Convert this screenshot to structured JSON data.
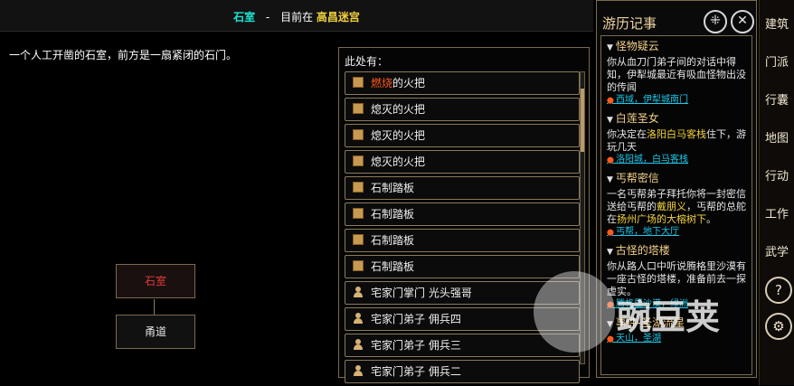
{
  "header": {
    "location": "石室",
    "separator": "-",
    "prefix": "目前在",
    "place": "高昌迷宫"
  },
  "description": "一个人工开凿的石室，前方是一扇紧闭的石门。",
  "map": {
    "current_room": "石室",
    "lower_room": "甬道"
  },
  "here_panel": {
    "header": "此处有：",
    "items": [
      {
        "prefix": "燃烧",
        "label": "的火把",
        "icon": "box-icon"
      },
      {
        "label": "熄灭的火把",
        "icon": "box-icon"
      },
      {
        "label": "熄灭的火把",
        "icon": "box-icon"
      },
      {
        "label": "熄灭的火把",
        "icon": "box-icon"
      },
      {
        "label": "石制踏板",
        "icon": "box-icon"
      },
      {
        "label": "石制踏板",
        "icon": "box-icon"
      },
      {
        "label": "石制踏板",
        "icon": "box-icon"
      },
      {
        "label": "石制踏板",
        "icon": "box-icon"
      },
      {
        "label": "宅家门掌门  光头强哥",
        "icon": "person-icon"
      },
      {
        "label": "宅家门弟子  佣兵四",
        "icon": "person-icon"
      },
      {
        "label": "宅家门弟子  佣兵三",
        "icon": "person-icon"
      },
      {
        "label": "宅家门弟子  佣兵二",
        "icon": "person-icon"
      }
    ]
  },
  "journal": {
    "title": "游历记事",
    "quests": [
      {
        "title": "怪物疑云",
        "text": "你从血刀门弟子间的对话中得知，伊犁城最近有吸血怪物出没的传闻",
        "location": "西域，伊犁城南门"
      },
      {
        "title": "白莲圣女",
        "text_a": "你决定在",
        "hi": "洛阳白马客栈",
        "text_b": "住下，游玩几天",
        "location": "洛阳城，白马客栈"
      },
      {
        "title": "丐帮密信",
        "text_a": "一名丐帮弟子拜托你将一封密信送给丐帮的",
        "hi": "戴朋义",
        "text_b": "，丐帮的总舵在",
        "hi2": "扬州广场的大榕树下",
        "text_c": "。",
        "location": "丐帮，地下大厅"
      },
      {
        "title": "古怪的塔楼",
        "text": "你从路人口中听说腾格里沙漠有一座古怪的塔楼，准备前去一探虚实。",
        "location": "腾格里沙漠，绿洲"
      },
      {
        "title": "事件-圣湖流星",
        "text": "",
        "location": "天山，圣湖"
      }
    ]
  },
  "sidebar": {
    "buttons": [
      "建筑",
      "门派",
      "行囊",
      "地图",
      "行动",
      "工作",
      "武学"
    ]
  },
  "watermark": {
    "text": "豌豆荚"
  }
}
